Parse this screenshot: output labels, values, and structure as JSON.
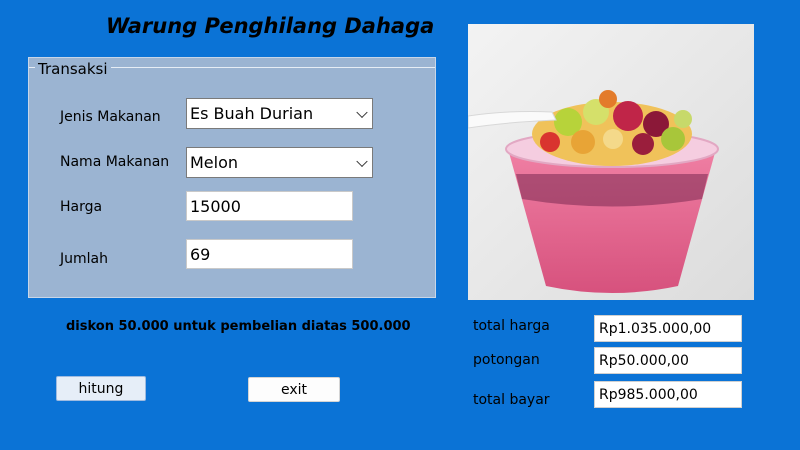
{
  "header": {
    "title": "Warung Penghilang Dahaga"
  },
  "transaksi": {
    "legend": "Transaksi",
    "jenis_label": "Jenis Makanan",
    "jenis_value": "Es Buah Durian",
    "nama_label": "Nama Makanan",
    "nama_value": "Melon",
    "harga_label": "Harga",
    "harga_value": "15000",
    "jumlah_label": "Jumlah",
    "jumlah_value": "69"
  },
  "note": "diskon 50.000 untuk pembelian diatas 500.000",
  "buttons": {
    "hitung": "hitung",
    "exit": "exit"
  },
  "summary": {
    "total_harga_label": "total harga",
    "total_harga_value": "Rp1.035.000,00",
    "potongan_label": "potongan",
    "potongan_value": "Rp50.000,00",
    "total_bayar_label": "total bayar",
    "total_bayar_value": "Rp985.000,00"
  },
  "image": {
    "icon": "fruit-ice-dessert-photo"
  },
  "colors": {
    "background": "#0b73d6",
    "groupbox": "#9bb4d2"
  }
}
